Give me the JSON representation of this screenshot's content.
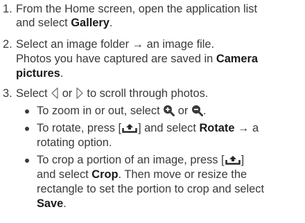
{
  "steps": [
    {
      "number": "1.",
      "line1_pre": "From the Home screen, open the application list",
      "line2_pre": "and select ",
      "line2_bold": "Gallery",
      "line2_post": "."
    },
    {
      "number": "2.",
      "line1": "Select an image folder → an image file.",
      "line2_pre": "Photos you have captured are saved in ",
      "line2_bold": "Camera",
      "line3_bold": "pictures",
      "line3_post": "."
    },
    {
      "number": "3.",
      "pre": "Select",
      "mid": "or",
      "post": "to scroll through photos.",
      "left_icon": "arrow-left-icon",
      "right_icon": "arrow-right-icon"
    }
  ],
  "bullets": [
    {
      "pre": "To zoom in or out, select",
      "mid": "or",
      "post": ".",
      "icons": [
        "zoom-in-icon",
        "zoom-out-icon"
      ]
    },
    {
      "line1_pre": "To rotate, press [",
      "line1_mid": "] and select ",
      "line1_bold": "Rotate",
      "line1_post": " → a",
      "line2": "rotating option.",
      "icon": "menu-key-icon"
    },
    {
      "line1_pre": "To crop a portion of an image, press [",
      "line1_post": "]",
      "line2_pre": "and select ",
      "line2_bold": "Crop",
      "line2_post": ". Then move or resize the",
      "line3": "rectangle to set the portion to crop and select",
      "line4_bold": "Save",
      "line4_post": ".",
      "icon": "menu-key-icon"
    }
  ]
}
